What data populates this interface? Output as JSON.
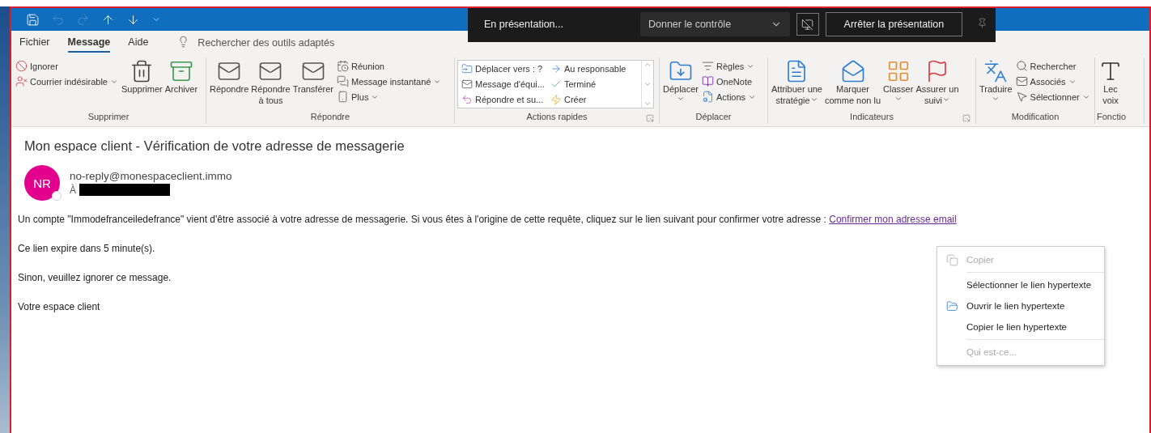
{
  "menu_tabs": [
    {
      "label": "Fichier",
      "selected": false
    },
    {
      "label": "Message",
      "selected": true
    },
    {
      "label": "Aide",
      "selected": false
    }
  ],
  "tell_me": {
    "label": "Rechercher des outils adaptés"
  },
  "ribbon": {
    "groups": [
      {
        "label": "Supprimer",
        "launcher": false,
        "items": [
          {
            "kind": "stack",
            "items": [
              {
                "label": "Ignorer",
                "dropdown": false
              },
              {
                "label": "Courrier indésirable",
                "dropdown": true
              }
            ]
          },
          {
            "kind": "large",
            "label": "Supprimer",
            "dropdown": false
          },
          {
            "kind": "large",
            "label": "Archiver",
            "dropdown": false
          }
        ]
      },
      {
        "label": "Répondre",
        "launcher": false,
        "items": [
          {
            "kind": "large",
            "label": "Répondre",
            "dropdown": false
          },
          {
            "kind": "large",
            "label": "Répondre\nà tous",
            "dropdown": false
          },
          {
            "kind": "large",
            "label": "Transférer",
            "dropdown": false
          },
          {
            "kind": "stack",
            "items": [
              {
                "label": "Réunion",
                "dropdown": false
              },
              {
                "label": "Message instantané",
                "dropdown": true
              },
              {
                "label": "Plus",
                "dropdown": true
              }
            ]
          }
        ]
      },
      {
        "label": "Actions rapides",
        "launcher": true,
        "items": [
          {
            "kind": "gallery",
            "items": [
              {
                "label": "Déplacer vers : ?"
              },
              {
                "label": "Au responsable"
              },
              {
                "label": "Message d'équi..."
              },
              {
                "label": "Terminé"
              },
              {
                "label": "Répondre et su..."
              },
              {
                "label": "Créer"
              }
            ]
          }
        ]
      },
      {
        "label": "Déplacer",
        "launcher": false,
        "items": [
          {
            "kind": "large",
            "label": "Déplacer",
            "dropdown": true
          },
          {
            "kind": "stack",
            "items": [
              {
                "label": "Règles",
                "dropdown": true
              },
              {
                "label": "OneNote",
                "dropdown": false
              },
              {
                "label": "Actions",
                "dropdown": true
              }
            ]
          }
        ]
      },
      {
        "label": "Indicateurs",
        "launcher": true,
        "items": [
          {
            "kind": "large",
            "label": "Attribuer une\nstratégie",
            "dropdown": true
          },
          {
            "kind": "large",
            "label": "Marquer\ncomme non lu",
            "dropdown": false
          },
          {
            "kind": "large",
            "label": "Classer",
            "dropdown": true
          },
          {
            "kind": "large",
            "label": "Assurer un\nsuivi",
            "dropdown": true
          }
        ]
      },
      {
        "label": "Modification",
        "launcher": false,
        "items": [
          {
            "kind": "large",
            "label": "Traduire",
            "dropdown": true
          },
          {
            "kind": "stack",
            "items": [
              {
                "label": "Rechercher",
                "dropdown": false
              },
              {
                "label": "Associés",
                "dropdown": true
              },
              {
                "label": "Sélectionner",
                "dropdown": true
              }
            ]
          }
        ]
      },
      {
        "label": "Fonctio",
        "launcher": false,
        "items": [
          {
            "kind": "large",
            "label": "Lec\nvoix",
            "dropdown": false
          }
        ]
      }
    ]
  },
  "presentation_bar": {
    "status": "En présentation...",
    "control_dropdown": "Donner le contrôle",
    "stop_button": "Arrêter la présentation"
  },
  "message": {
    "subject": "Mon espace client - Vérification de votre adresse de messagerie",
    "avatar_initials": "NR",
    "sender": "no-reply@monespaceclient.immo",
    "to_label": "À",
    "paragraphs": [
      {
        "text": "Un compte \"Immodefranceiledefrance\" vient d'être associé à votre adresse de messagerie. Si vous êtes à l'origine de cette requête, cliquez sur le lien suivant pour confirmer votre adresse : ",
        "link": "Confirmer mon adresse email"
      },
      {
        "text": "Ce lien expire dans 5 minute(s)."
      },
      {
        "text": "Sinon, veuillez ignorer ce message."
      },
      {
        "text": "Votre espace client"
      }
    ]
  },
  "context_menu": [
    {
      "kind": "item",
      "label": "Copier",
      "disabled": true
    },
    {
      "kind": "separator"
    },
    {
      "kind": "item",
      "label": "Sélectionner le lien hypertexte",
      "disabled": false
    },
    {
      "kind": "item",
      "label": "Ouvrir le lien hypertexte",
      "disabled": false
    },
    {
      "kind": "item",
      "label": "Copier le lien hypertexte",
      "disabled": false
    },
    {
      "kind": "separator"
    },
    {
      "kind": "item",
      "label": "Qui est-ce...",
      "disabled": true
    }
  ]
}
